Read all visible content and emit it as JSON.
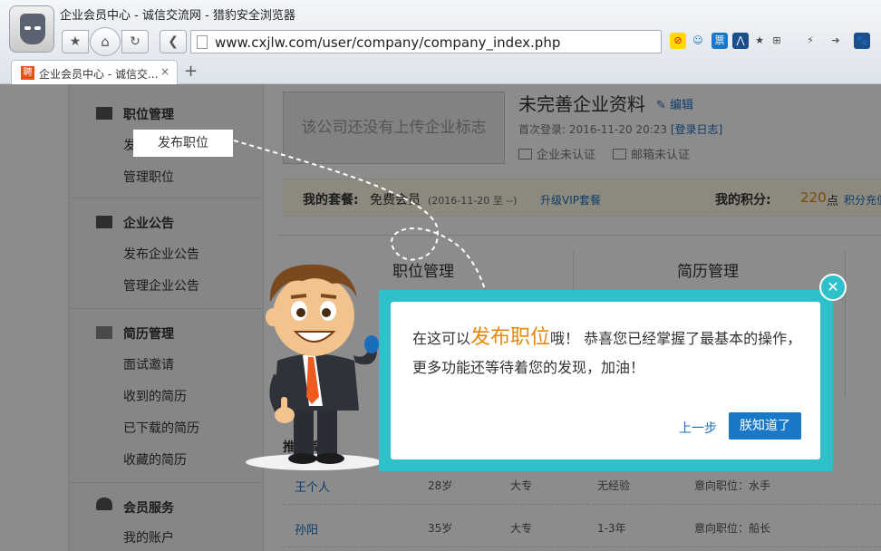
{
  "browser": {
    "window_title": "企业会员中心 - 诚信交流网 - 猎豹安全浏览器",
    "url": "www.cxjlw.com/user/company/company_index.php",
    "tab_title": "企业会员中心 - 诚信交...",
    "tab_favicon": "聘",
    "tab_close": "×",
    "new_tab": "+",
    "nav_icons": {
      "star": "★",
      "home": "⌂",
      "refresh": "↻",
      "back": "❮"
    },
    "right_icons": [
      "⊘",
      "☺",
      "票",
      "⋀",
      "★",
      "⊞",
      "⚡",
      "➔",
      "🐾"
    ]
  },
  "sidebar": {
    "groups": [
      {
        "title": "职位管理",
        "items": [
          "发布职位",
          "管理职位"
        ]
      },
      {
        "title": "企业公告",
        "items": [
          "发布企业公告",
          "管理企业公告"
        ]
      },
      {
        "title": "简历管理",
        "items": [
          "面试邀请",
          "收到的简历",
          "已下载的简历",
          "收藏的简历"
        ]
      },
      {
        "title": "会员服务",
        "items": [
          "我的账户"
        ]
      }
    ]
  },
  "company": {
    "logo_placeholder": "该公司还没有上传企业标志",
    "name": "未完善企业资料",
    "edit": "编辑",
    "last_login_label": "首次登录:",
    "last_login_time": "2016-11-20 20:23",
    "login_log": "[登录日志]",
    "company_verify": "企业未认证",
    "email_verify": "邮箱未认证"
  },
  "plan": {
    "label": "我的套餐:",
    "value": "免费会员",
    "dates": "(2016-11-20 至 --)",
    "upgrade": "升级VIP套餐",
    "points_label": "我的积分:",
    "points_value": "220",
    "points_unit": "点",
    "recharge": "积分充值"
  },
  "panel": {
    "col1": "职位管理",
    "col2": "简历管理"
  },
  "recommended": {
    "title": "推荐简历",
    "rows": [
      {
        "name": "王个人",
        "age": "28岁",
        "edu": "大专",
        "exp": "无经验",
        "intent": "意向职位：水手"
      },
      {
        "name": "孙阳",
        "age": "35岁",
        "edu": "大专",
        "exp": "1-3年",
        "intent": "意向职位：船长"
      }
    ]
  },
  "guide": {
    "highlight": "发布职位",
    "text_before": "在这可以",
    "text_highlight": "发布职位",
    "text_after": "哦！ 恭喜您已经掌握了最基本的操作，更多功能还等待着您的发现，加油！",
    "prev": "上一步",
    "ok": "朕知道了",
    "close": "✕"
  },
  "colors": {
    "accent": "#2fc1c9",
    "link": "#1a6dbd",
    "button": "#1a78c8",
    "highlight_text": "#e8870e"
  }
}
